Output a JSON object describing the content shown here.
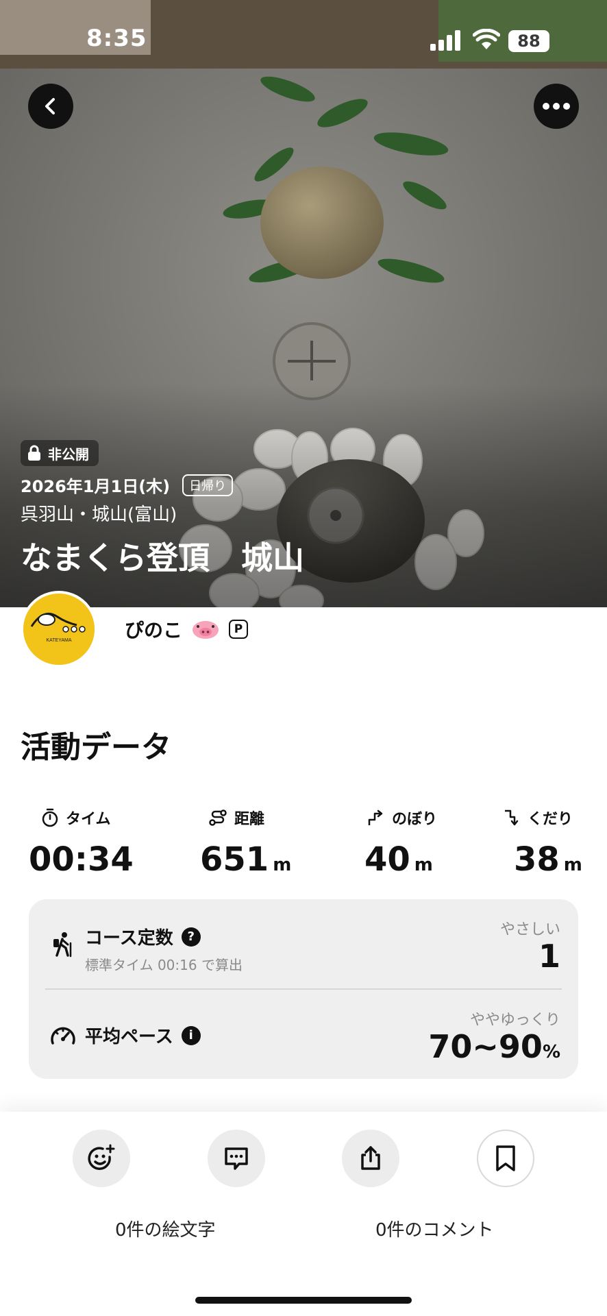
{
  "status_bar": {
    "time": "8:35",
    "battery": "88"
  },
  "hero": {
    "private_label": "非公開",
    "date": "2026年1月1日(木)",
    "trip_type": "日帰り",
    "place": "呉羽山・城山(富山)",
    "title": "なまくら登頂　城山"
  },
  "user": {
    "name": "ぴのこ",
    "badge": "P",
    "avatar_text": "KATEYAMA"
  },
  "activity": {
    "section_title": "活動データ",
    "stats": [
      {
        "label": "タイム",
        "value": "00:34",
        "unit": "",
        "icon": "stopwatch-icon"
      },
      {
        "label": "距離",
        "value": "651",
        "unit": "m",
        "icon": "route-icon"
      },
      {
        "label": "のぼり",
        "value": "40",
        "unit": "m",
        "icon": "ascent-icon"
      },
      {
        "label": "くだり",
        "value": "38",
        "unit": "m",
        "icon": "descent-icon"
      }
    ],
    "course_constant": {
      "title": "コース定数",
      "subtitle": "標準タイム 00:16 で算出",
      "rating": "やさしい",
      "value": "1"
    },
    "average_pace": {
      "title": "平均ペース",
      "rating": "ややゆっくり",
      "value": "70~90",
      "unit": "%"
    }
  },
  "bottom": {
    "emoji_count": "0件の絵文字",
    "comment_count": "0件のコメント"
  }
}
